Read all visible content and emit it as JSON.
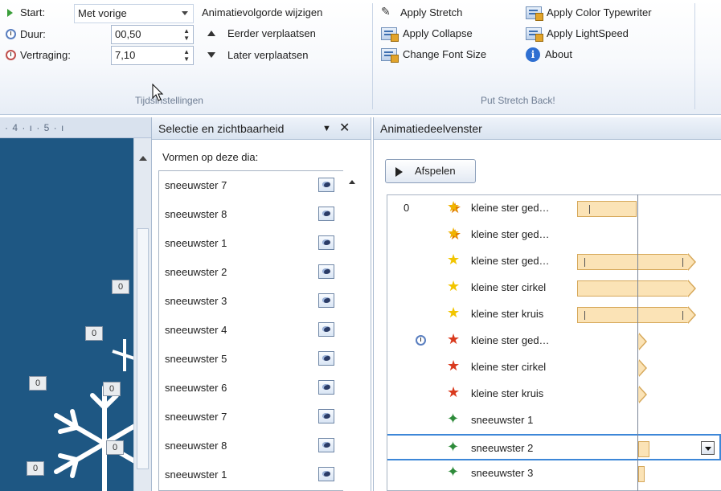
{
  "ribbon": {
    "timing": {
      "start_label": "Start:",
      "start_value": "Met vorige",
      "duration_label": "Duur:",
      "duration_value": "00,50",
      "delay_label": "Vertraging:",
      "delay_value": "7,10",
      "reorder_title": "Animatievolgorde wijzigen",
      "move_earlier": "Eerder verplaatsen",
      "move_later": "Later verplaatsen",
      "group_label": "Tijdsinstellingen"
    },
    "addin": {
      "apply_stretch": "Apply Stretch",
      "apply_color_typewriter": "Apply Color Typewriter",
      "apply_collapse": "Apply Collapse",
      "apply_lightspeed": "Apply LightSpeed",
      "change_font_size": "Change Font Size",
      "about": "About",
      "group_label": "Put Stretch Back!"
    }
  },
  "ruler": {
    "text": "· 4 · ı · 5 · ı"
  },
  "slide": {
    "badges": [
      "0",
      "0",
      "0",
      "0",
      "0",
      "0"
    ]
  },
  "selection_pane": {
    "title": "Selectie en zichtbaarheid",
    "subtitle": "Vormen op deze dia:",
    "items": [
      "sneeuwster 7",
      "sneeuwster 8",
      "sneeuwster 1",
      "sneeuwster 2",
      "sneeuwster 3",
      "sneeuwster 4",
      "sneeuwster 5",
      "sneeuwster 6",
      "sneeuwster 7",
      "sneeuwster 8",
      "sneeuwster 1"
    ]
  },
  "animation_pane": {
    "title": "Animatiedeelvenster",
    "play_label": "Afspelen",
    "rows": [
      {
        "num": "0",
        "label": "kleine ster ged…",
        "icon": "multi-star-icon"
      },
      {
        "num": "",
        "label": "kleine ster ged…",
        "icon": "multi-star-icon"
      },
      {
        "num": "",
        "label": "kleine ster ged…",
        "icon": "yellow-star-icon"
      },
      {
        "num": "",
        "label": "kleine ster cirkel",
        "icon": "yellow-star-icon"
      },
      {
        "num": "",
        "label": "kleine ster kruis",
        "icon": "yellow-star-icon"
      },
      {
        "num": "",
        "label": "kleine ster ged…",
        "icon": "red-star-icon"
      },
      {
        "num": "",
        "label": "kleine ster cirkel",
        "icon": "red-star-icon"
      },
      {
        "num": "",
        "label": "kleine ster kruis",
        "icon": "red-star-icon"
      },
      {
        "num": "",
        "label": "sneeuwster 1",
        "icon": "green-star-icon"
      },
      {
        "num": "",
        "label": "sneeuwster 2",
        "icon": "green-star-icon"
      },
      {
        "num": "",
        "label": "sneeuwster 3",
        "icon": "green-star-icon"
      }
    ]
  },
  "colors": {
    "accent": "#3d87d8",
    "slide_bg": "#1e5783",
    "timeline_bar": "#fbe3b6"
  }
}
